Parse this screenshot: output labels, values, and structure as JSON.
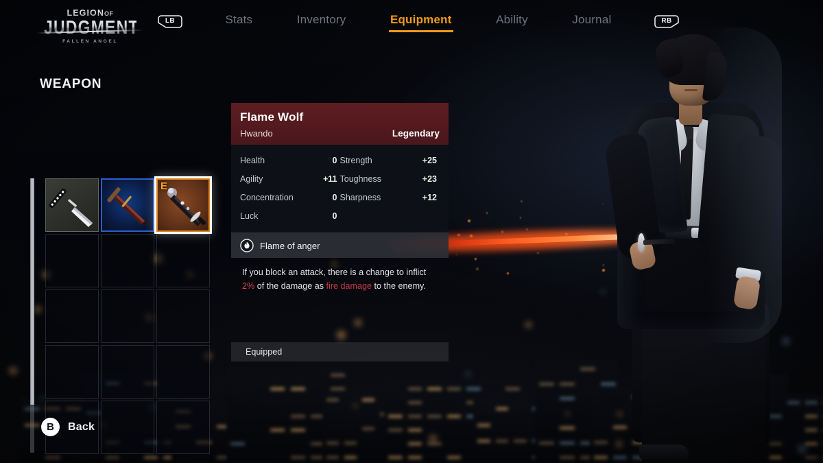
{
  "header": {
    "logo": {
      "line1": "LEGION",
      "of": "OF",
      "line2": "JUDGMENT",
      "subtitle": "FALLEN ANGEL"
    },
    "bumper_left": "LB",
    "bumper_right": "RB",
    "tabs": [
      {
        "label": "Stats",
        "active": false
      },
      {
        "label": "Inventory",
        "active": false
      },
      {
        "label": "Equipment",
        "active": true
      },
      {
        "label": "Ability",
        "active": false
      },
      {
        "label": "Journal",
        "active": false
      }
    ],
    "accent_color": "#f09a1a"
  },
  "weapon_section": {
    "title": "WEAPON",
    "grid": {
      "columns": 3,
      "rows": 5,
      "slots": [
        {
          "index": 0,
          "filled": true,
          "rarity": "common",
          "icon": "katana-white-blade",
          "selected": false,
          "badge": ""
        },
        {
          "index": 1,
          "filled": true,
          "rarity": "rare",
          "icon": "sword-dark-blade",
          "selected": false,
          "badge": ""
        },
        {
          "index": 2,
          "filled": true,
          "rarity": "legendary",
          "icon": "flame-katana",
          "selected": true,
          "badge": "E"
        },
        {
          "index": 3,
          "filled": false,
          "rarity": "empty",
          "icon": "",
          "selected": false,
          "badge": ""
        },
        {
          "index": 4,
          "filled": false,
          "rarity": "empty",
          "icon": "",
          "selected": false,
          "badge": ""
        },
        {
          "index": 5,
          "filled": false,
          "rarity": "empty",
          "icon": "",
          "selected": false,
          "badge": ""
        },
        {
          "index": 6,
          "filled": false,
          "rarity": "empty",
          "icon": "",
          "selected": false,
          "badge": ""
        },
        {
          "index": 7,
          "filled": false,
          "rarity": "empty",
          "icon": "",
          "selected": false,
          "badge": ""
        },
        {
          "index": 8,
          "filled": false,
          "rarity": "empty",
          "icon": "",
          "selected": false,
          "badge": ""
        },
        {
          "index": 9,
          "filled": false,
          "rarity": "empty",
          "icon": "",
          "selected": false,
          "badge": ""
        },
        {
          "index": 10,
          "filled": false,
          "rarity": "empty",
          "icon": "",
          "selected": false,
          "badge": ""
        },
        {
          "index": 11,
          "filled": false,
          "rarity": "empty",
          "icon": "",
          "selected": false,
          "badge": ""
        },
        {
          "index": 12,
          "filled": false,
          "rarity": "empty",
          "icon": "",
          "selected": false,
          "badge": ""
        },
        {
          "index": 13,
          "filled": false,
          "rarity": "empty",
          "icon": "",
          "selected": false,
          "badge": ""
        },
        {
          "index": 14,
          "filled": false,
          "rarity": "empty",
          "icon": "",
          "selected": false,
          "badge": ""
        }
      ]
    },
    "rarity_colors": {
      "common": "#9aa0a0",
      "rare": "#2a5fd0",
      "legendary": "#e0861f"
    }
  },
  "item_panel": {
    "name": "Flame Wolf",
    "type": "Hwando",
    "rarity": "Legendary",
    "header_color": "#5d1d22",
    "stats": [
      {
        "label": "Health",
        "value": "0",
        "positive": false
      },
      {
        "label": "Strength",
        "value": "+25",
        "positive": true
      },
      {
        "label": "Agility",
        "value": "+11",
        "positive": true
      },
      {
        "label": "Toughness",
        "value": "+23",
        "positive": true
      },
      {
        "label": "Concentration",
        "value": "0",
        "positive": false
      },
      {
        "label": "Sharpness",
        "value": "+12",
        "positive": true
      },
      {
        "label": "Luck",
        "value": "0",
        "positive": false
      },
      {
        "label": "",
        "value": "",
        "positive": false
      }
    ],
    "perk": {
      "icon": "flame-icon",
      "name": "Flame of anger",
      "description_part1": "If you block an attack, there is a change to inflict ",
      "description_highlight1": "2%",
      "description_part2": " of the damage as ",
      "description_highlight2": "fire damage",
      "description_part3": " to the enemy.",
      "highlight_color": "#c23b43"
    },
    "status": "Equipped"
  },
  "footer": {
    "button_glyph": "B",
    "button_label": "Back"
  }
}
